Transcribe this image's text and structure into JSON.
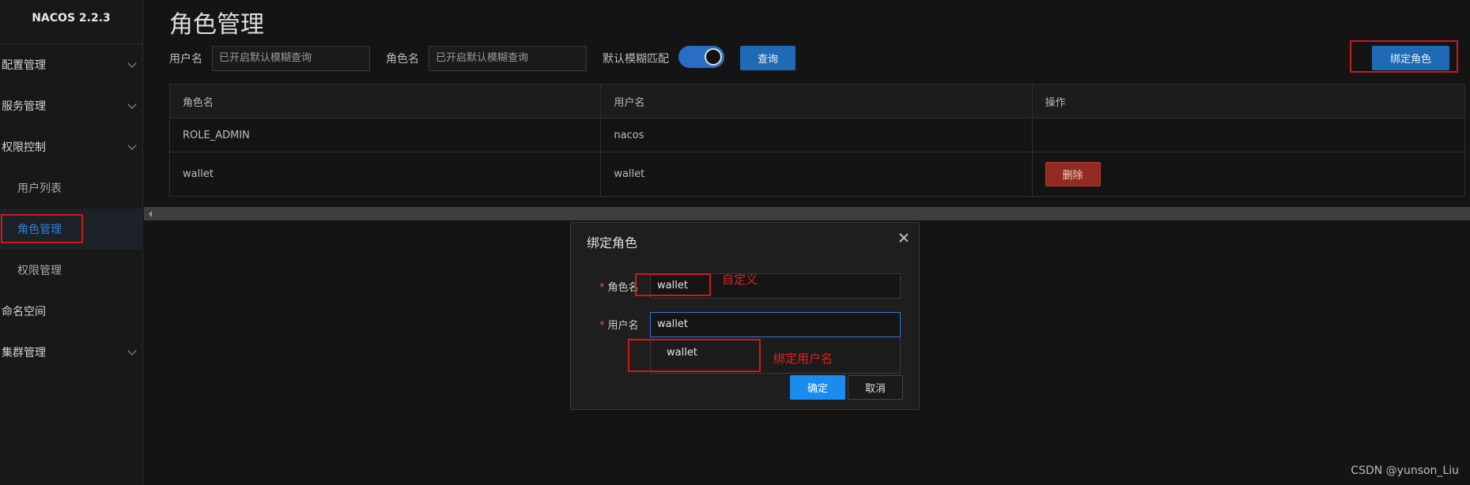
{
  "app": {
    "title": "NACOS 2.2.3"
  },
  "sidebar": {
    "items": [
      {
        "label": "配置管理",
        "expandable": true
      },
      {
        "label": "服务管理",
        "expandable": true
      },
      {
        "label": "权限控制",
        "expandable": true
      },
      {
        "label": "用户列表",
        "sub": true
      },
      {
        "label": "角色管理",
        "sub": true,
        "active": true
      },
      {
        "label": "权限管理",
        "sub": true
      },
      {
        "label": "命名空间",
        "expandable": false
      },
      {
        "label": "集群管理",
        "expandable": true
      }
    ]
  },
  "page": {
    "title": "角色管理"
  },
  "filters": {
    "username_label": "用户名",
    "username_placeholder": "已开启默认模糊查询",
    "role_label": "角色名",
    "role_placeholder": "已开启默认模糊查询",
    "fuzzy_label": "默认模糊匹配",
    "fuzzy_on": true,
    "search_button": "查询",
    "bind_role_button": "绑定角色"
  },
  "table": {
    "headers": [
      "角色名",
      "用户名",
      "操作"
    ],
    "rows": [
      {
        "role": "ROLE_ADMIN",
        "user": "nacos",
        "action": ""
      },
      {
        "role": "wallet",
        "user": "wallet",
        "action": "删除"
      }
    ]
  },
  "dialog": {
    "title": "绑定角色",
    "role_label": "角色名",
    "role_value": "wallet",
    "user_label": "用户名",
    "user_value": "wallet",
    "suggestion": "wallet",
    "ok_button": "确定",
    "cancel_button": "取消"
  },
  "annotations": {
    "custom_note": "自定义",
    "bind_user_note": "绑定用户名",
    "color": "#d11818"
  },
  "watermark": "CSDN @yunson_Liu",
  "colors": {
    "accent": "#1e6ab5",
    "danger": "#922b21",
    "primary": "#1a8cf0"
  }
}
